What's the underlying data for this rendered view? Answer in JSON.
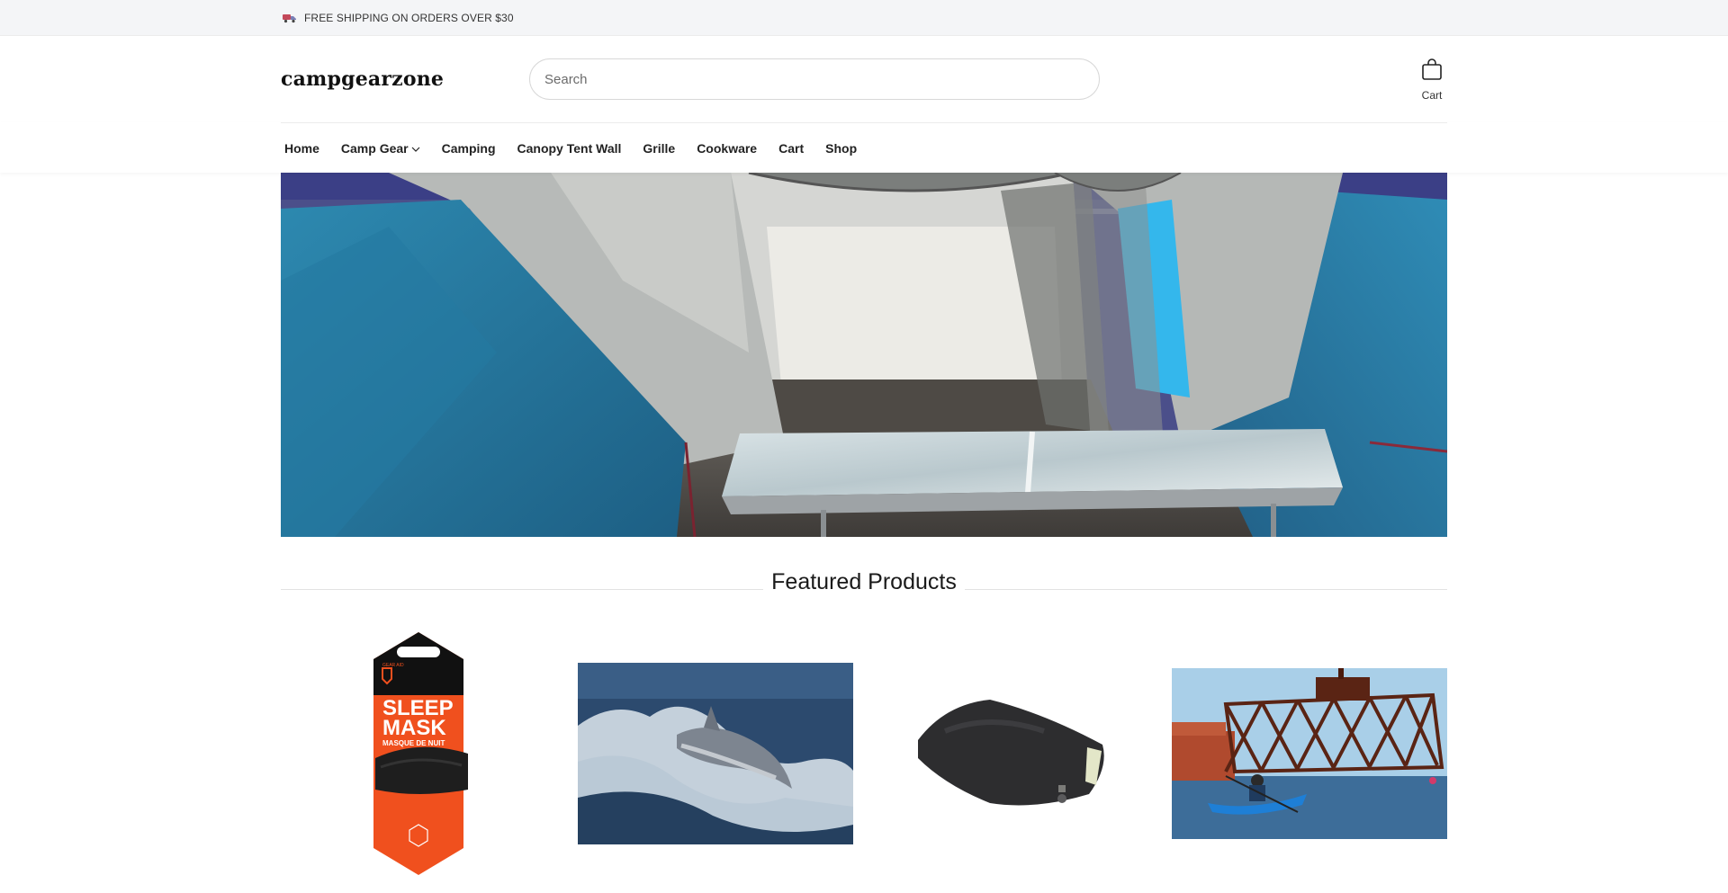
{
  "announcement": {
    "text": "FREE SHIPPING ON ORDERS OVER $30",
    "icon": "truck-icon"
  },
  "header": {
    "logo": "campgearzone",
    "search": {
      "placeholder": "Search",
      "value": ""
    },
    "cart": {
      "label": "Cart",
      "icon": "shopping-bag-icon"
    }
  },
  "nav": {
    "items": [
      {
        "label": "Home"
      },
      {
        "label": "Camp Gear",
        "has_dropdown": true
      },
      {
        "label": "Camping"
      },
      {
        "label": "Canopy Tent Wall"
      },
      {
        "label": "Grille"
      },
      {
        "label": "Cookware"
      },
      {
        "label": "Cart"
      },
      {
        "label": "Shop"
      }
    ]
  },
  "hero": {
    "image": "tent-with-folding-table-photo"
  },
  "featured": {
    "title": "Featured Products",
    "products": [
      {
        "image": "sleep-mask-package-photo",
        "package_brand": "GEAR AID",
        "package_title_1": "SLEEP",
        "package_title_2": "MASK",
        "package_subtitle": "MASQUE DE NUIT"
      },
      {
        "image": "dolphin-in-waves-photo"
      },
      {
        "image": "camping-pillow-photo"
      },
      {
        "image": "kayaker-near-bridge-photo"
      }
    ]
  },
  "colors": {
    "announcement_bg": "#f4f5f7",
    "text": "#222222",
    "accent_orange": "#f0501e",
    "hero_tent_blue": "#2a7ea4"
  }
}
